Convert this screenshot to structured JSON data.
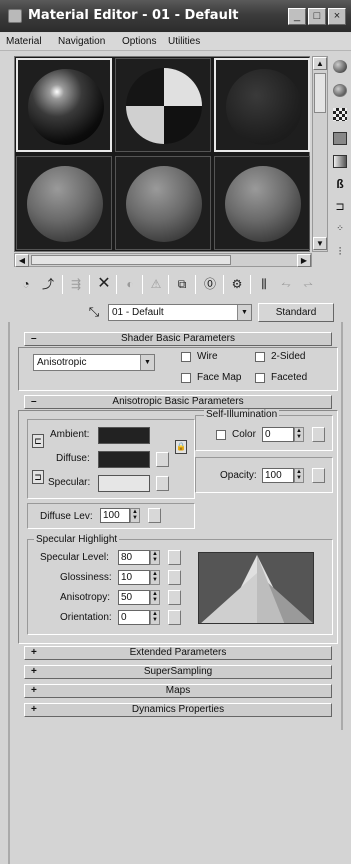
{
  "window": {
    "title": "Material Editor - 01 - Default",
    "buttons": {
      "minimize": "_",
      "maximize": "□",
      "close": "×"
    }
  },
  "menu": [
    "Material",
    "Navigation",
    "Options",
    "Utilities"
  ],
  "slots": {
    "selected_index": 0,
    "count": 6
  },
  "toolbar": {
    "material_name": "01 - Default",
    "material_type": "Standard"
  },
  "shader_basic": {
    "header": "Shader Basic Parameters",
    "shader": "Anisotropic",
    "wire": "Wire",
    "two_sided": "2-Sided",
    "face_map": "Face Map",
    "faceted": "Faceted"
  },
  "aniso_basic": {
    "header": "Anisotropic Basic Parameters",
    "ambient": "Ambient:",
    "diffuse": "Diffuse:",
    "specular": "Specular:",
    "self_illum_title": "Self-Illumination",
    "color": "Color",
    "color_value": "0",
    "opacity": "Opacity:",
    "opacity_value": "100",
    "diffuse_lev": "Diffuse Lev:",
    "diffuse_lev_value": "100",
    "ambient_color": "#222222",
    "diffuse_color": "#222222",
    "specular_color": "#e6e6e6"
  },
  "specular_highlight": {
    "title": "Specular Highlight",
    "spec_level": "Specular Level:",
    "spec_level_value": "80",
    "glossiness": "Glossiness:",
    "glossiness_value": "10",
    "anisotropy": "Anisotropy:",
    "anisotropy_value": "50",
    "orientation": "Orientation:",
    "orientation_value": "0"
  },
  "collapsed_rollouts": [
    "Extended Parameters",
    "SuperSampling",
    "Maps",
    "Dynamics Properties"
  ]
}
